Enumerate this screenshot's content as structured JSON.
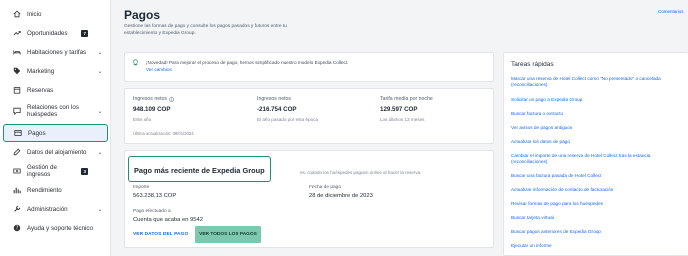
{
  "sidebar": {
    "items": [
      {
        "label": "Inicio",
        "icon": "home-icon"
      },
      {
        "label": "Oportunidades",
        "icon": "trend-up-icon",
        "badge": "7"
      },
      {
        "label": "Habitaciones y tarifas",
        "icon": "bed-icon",
        "chevron": "⌄"
      },
      {
        "label": "Marketing",
        "icon": "tag-icon",
        "chevron": "⌄"
      },
      {
        "label": "Reservas",
        "icon": "calendar-icon"
      },
      {
        "label": "Relaciones con los huéspedes",
        "icon": "chat-icon",
        "chevron": "⌄"
      },
      {
        "label": "Pagos",
        "icon": "payment-icon",
        "active": true
      },
      {
        "label": "Datos del alojamiento",
        "icon": "edit-icon",
        "chevron": "⌄"
      },
      {
        "label": "Gestión de ingresos",
        "icon": "money-icon",
        "badge": "3"
      },
      {
        "label": "Rendimiento",
        "icon": "chart-icon"
      },
      {
        "label": "Administración",
        "icon": "wrench-icon",
        "chevron": "⌄"
      },
      {
        "label": "Ayuda y soporte técnico",
        "icon": "help-icon"
      }
    ]
  },
  "header": {
    "title": "Pagos",
    "subtitle": "Gestione las formas de pago y consulte los pagos pasados y futuros entre tu establecimiento y Expedia Group.",
    "comments": "Comentarios"
  },
  "notice": {
    "text": "¡Novedad! Para mejorar el proceso de pago, hemos simplificado nuestro modelo Expedia Collect.",
    "link": "Ver cambios"
  },
  "stats": {
    "items": [
      {
        "label": "Ingresos netos",
        "value": "948.109 COP",
        "sub": "Este año",
        "info": true
      },
      {
        "label": "Ingresos netos",
        "value": "-216.754 COP",
        "sub": "El año pasado por esta época"
      },
      {
        "label": "Tarifa media por noche",
        "value": "129.597 COP",
        "sub": "Los últimos 12 meses"
      }
    ],
    "updated": "Última actualización: 09/01/2024"
  },
  "recent": {
    "title": "Pago más reciente de Expedia Group",
    "desc": "es, cuando los huéspedes paguen online al hacer la reserva.",
    "amount_label": "Importe",
    "amount": "563.238,13 COP",
    "date_label": "Fecha de pago",
    "date": "28 de diciembre de 2023",
    "account_label": "Pago efectuado a",
    "account": "Cuenta que acaba en 9542",
    "details_button": "VER DATOS DEL PAGO",
    "all_button": "VER TODOS LOS PAGOS"
  },
  "tasks": {
    "title": "Tareas rápidas",
    "items": [
      "Marcar una reserva de Hotel Collect como \"No presentado\" o cancelada (reconciliaciones)",
      "Solicitar un pago a Expedia Group",
      "Buscar factura o extracto",
      "Ver avisos de pagos antiguos",
      "Actualizar los datos de pago",
      "Cambiar el importe de una reserva de Hotel Collect tras la estancia (reconciliaciones)",
      "Buscar una factura pasada de Hotel Collect",
      "Actualizar información de contacto de facturación",
      "Revisar formas de pago para los huéspedes",
      "Buscar tarjeta virtual",
      "Buscar pagos anteriores de Expedia Group",
      "Ejecutar un informe"
    ]
  },
  "colors": {
    "accent": "#1668e3",
    "highlight_border": "#1a9468",
    "primary_button": "#7fc8b0"
  }
}
